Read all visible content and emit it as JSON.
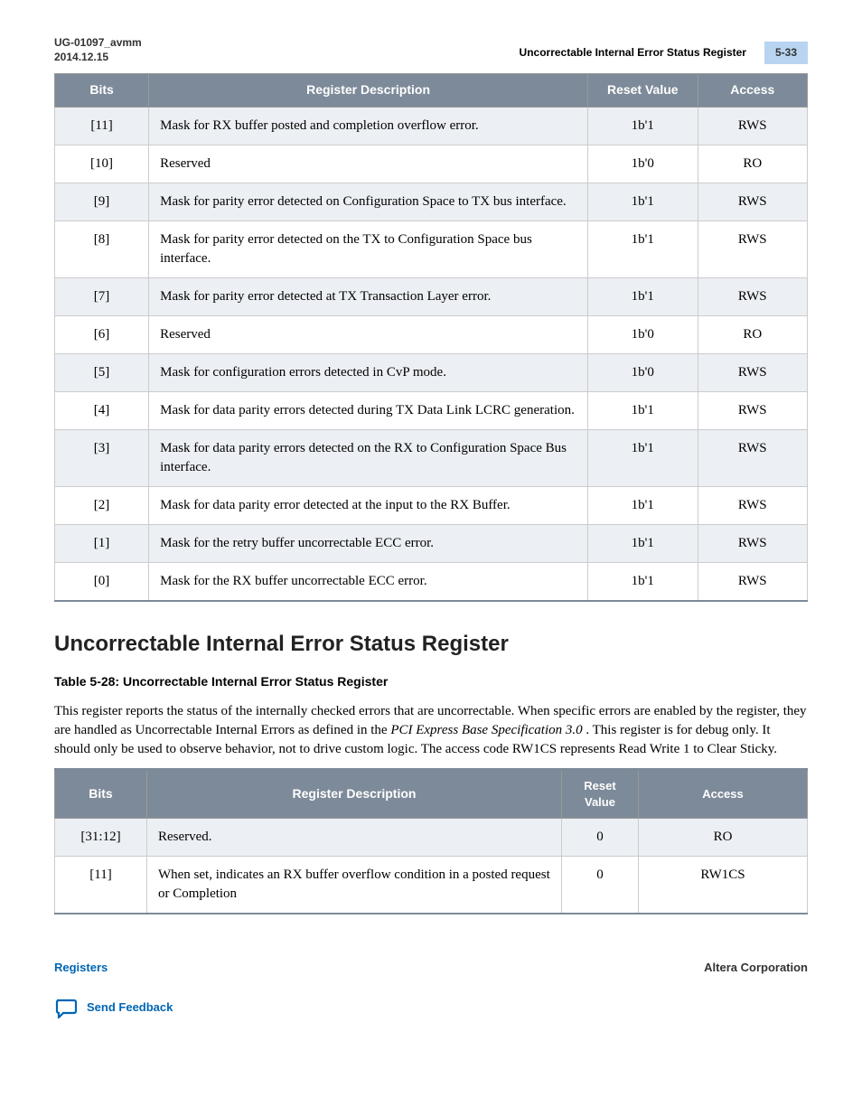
{
  "header": {
    "doc_id": "UG-01097_avmm",
    "date": "2014.12.15",
    "section_title": "Uncorrectable Internal Error Status Register",
    "page_num": "5-33"
  },
  "table1": {
    "headers": [
      "Bits",
      "Register Description",
      "Reset Value",
      "Access"
    ],
    "rows": [
      {
        "bits": "[11]",
        "desc": "Mask for RX buffer posted and completion overflow error.",
        "reset": "1b'1",
        "access": "RWS"
      },
      {
        "bits": "[10]",
        "desc": "Reserved",
        "reset": "1b'0",
        "access": "RO"
      },
      {
        "bits": "[9]",
        "desc": "Mask for parity error detected on Configuration Space to TX bus interface.",
        "reset": "1b'1",
        "access": "RWS"
      },
      {
        "bits": "[8]",
        "desc": "Mask for parity error detected on the TX to Configuration Space bus interface.",
        "reset": "1b'1",
        "access": "RWS"
      },
      {
        "bits": "[7]",
        "desc": "Mask for parity error detected at TX Transaction Layer error.",
        "reset": "1b'1",
        "access": "RWS"
      },
      {
        "bits": "[6]",
        "desc": "Reserved",
        "reset": "1b'0",
        "access": "RO"
      },
      {
        "bits": "[5]",
        "desc": "Mask for configuration errors detected in CvP mode.",
        "reset": "1b'0",
        "access": "RWS"
      },
      {
        "bits": "[4]",
        "desc": "Mask for data parity errors detected during TX Data Link LCRC generation.",
        "reset": "1b'1",
        "access": "RWS"
      },
      {
        "bits": "[3]",
        "desc": "Mask for data parity errors detected on the RX to Configuration Space Bus interface.",
        "reset": "1b'1",
        "access": "RWS"
      },
      {
        "bits": "[2]",
        "desc": "Mask for data parity error detected at the input to the RX Buffer.",
        "reset": "1b'1",
        "access": "RWS"
      },
      {
        "bits": "[1]",
        "desc": "Mask for the retry buffer uncorrectable ECC error.",
        "reset": "1b'1",
        "access": "RWS"
      },
      {
        "bits": "[0]",
        "desc": "Mask for the RX buffer uncorrectable ECC error.",
        "reset": "1b'1",
        "access": "RWS"
      }
    ]
  },
  "section_heading": "Uncorrectable Internal Error Status Register",
  "table2_caption": "Table 5-28: Uncorrectable Internal Error Status Register",
  "section_para_part1": "This register reports the status of the internally checked errors that are uncorrectable. When specific errors are enabled by the ",
  "section_para_part2": " register, they are handled as Uncorrectable Internal Errors as defined in the ",
  "spec_italic": "PCI Express Base Specification 3.0",
  "section_para_part3": ". This register is for debug only. It should only be used to observe behavior, not to drive custom logic. The access code RW1CS represents Read Write 1 to Clear Sticky.",
  "table2": {
    "headers": [
      "Bits",
      "Register Description",
      "Reset Value",
      "Access"
    ],
    "rows": [
      {
        "bits": "[31:12]",
        "desc": "Reserved.",
        "reset": "0",
        "access": "RO"
      },
      {
        "bits": "[11]",
        "desc": "When set, indicates an RX buffer overflow condition in a posted request or Completion",
        "reset": "0",
        "access": "RW1CS"
      }
    ]
  },
  "footer": {
    "left": "Registers",
    "right": "Altera Corporation",
    "feedback": "Send Feedback"
  }
}
